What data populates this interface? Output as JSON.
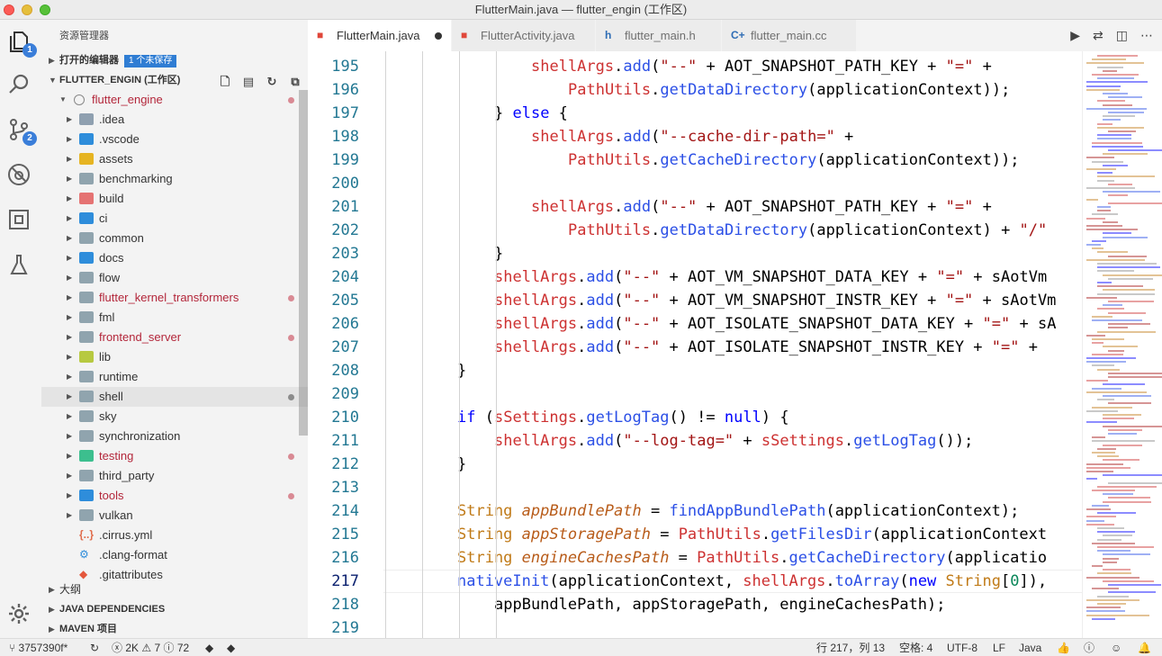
{
  "window": {
    "title": "FlutterMain.java — flutter_engin (工作区)"
  },
  "activity": {
    "explorer_badge": "1",
    "scm_badge": "2"
  },
  "sidebar": {
    "title": "资源管理器",
    "open_editors": {
      "label": "打开的编辑器",
      "badge": "1 个未保存"
    },
    "workspace": {
      "label": "FLUTTER_ENGIN (工作区)"
    },
    "tree": [
      {
        "name": "flutter_engine",
        "root": true,
        "modified": true
      },
      {
        "name": ".idea",
        "icon_color": "#8fa0b0"
      },
      {
        "name": ".vscode",
        "icon_color": "#2e8ddb"
      },
      {
        "name": "assets",
        "icon_color": "#e6b422"
      },
      {
        "name": "benchmarking",
        "icon_color": "#90a4ae"
      },
      {
        "name": "build",
        "icon_color": "#e57373"
      },
      {
        "name": "ci",
        "icon_color": "#2e8ddb"
      },
      {
        "name": "common",
        "icon_color": "#90a4ae"
      },
      {
        "name": "docs",
        "icon_color": "#2e8ddb"
      },
      {
        "name": "flow",
        "icon_color": "#90a4ae"
      },
      {
        "name": "flutter_kernel_transformers",
        "icon_color": "#90a4ae",
        "modified": true
      },
      {
        "name": "fml",
        "icon_color": "#90a4ae"
      },
      {
        "name": "frontend_server",
        "icon_color": "#90a4ae",
        "modified": true
      },
      {
        "name": "lib",
        "icon_color": "#b7c940"
      },
      {
        "name": "runtime",
        "icon_color": "#90a4ae"
      },
      {
        "name": "shell",
        "icon_color": "#90a4ae",
        "selected": true,
        "gray_dot": true
      },
      {
        "name": "sky",
        "icon_color": "#90a4ae"
      },
      {
        "name": "synchronization",
        "icon_color": "#90a4ae"
      },
      {
        "name": "testing",
        "icon_color": "#3cbf8e",
        "modified": true
      },
      {
        "name": "third_party",
        "icon_color": "#90a4ae"
      },
      {
        "name": "tools",
        "icon_color": "#2e8ddb",
        "modified": true
      },
      {
        "name": "vulkan",
        "icon_color": "#90a4ae"
      },
      {
        "name": ".cirrus.yml",
        "file": true,
        "glyph": "{..}",
        "icon_color": "#e06c4b"
      },
      {
        "name": ".clang-format",
        "file": true,
        "glyph": "⚙",
        "icon_color": "#2e8ddb"
      },
      {
        "name": ".gitattributes",
        "file": true,
        "glyph": "◆",
        "icon_color": "#e4573c"
      }
    ],
    "outline": {
      "label": "大纲"
    },
    "java_deps": {
      "label": "JAVA DEPENDENCIES"
    },
    "maven": {
      "label": "MAVEN 项目"
    }
  },
  "tabs": [
    {
      "label": "FlutterMain.java",
      "icon": "java-icon",
      "active": true,
      "dirty": true
    },
    {
      "label": "FlutterActivity.java",
      "icon": "java-icon"
    },
    {
      "label": "flutter_main.h",
      "icon": "h-icon"
    },
    {
      "label": "flutter_main.cc",
      "icon": "cpp-icon"
    }
  ],
  "editor": {
    "current_line": "217",
    "lines": [
      {
        "n": "195",
        "indent": 4,
        "t": [
          [
            "v",
            "shellArgs"
          ],
          [
            "p",
            "."
          ],
          [
            "m",
            "add"
          ],
          [
            "p",
            "("
          ],
          [
            "s",
            "\"--\""
          ],
          [
            "p",
            " + AOT_SNAPSHOT_PATH_KEY + "
          ],
          [
            "s",
            "\"=\""
          ],
          [
            "p",
            " +"
          ]
        ]
      },
      {
        "n": "196",
        "indent": 5,
        "t": [
          [
            "v",
            "PathUtils"
          ],
          [
            "p",
            "."
          ],
          [
            "m",
            "getDataDirectory"
          ],
          [
            "p",
            "(applicationContext));"
          ]
        ]
      },
      {
        "n": "197",
        "indent": 3,
        "t": [
          [
            "p",
            "} "
          ],
          [
            "k",
            "else"
          ],
          [
            "p",
            " {"
          ]
        ]
      },
      {
        "n": "198",
        "indent": 4,
        "t": [
          [
            "v",
            "shellArgs"
          ],
          [
            "p",
            "."
          ],
          [
            "m",
            "add"
          ],
          [
            "p",
            "("
          ],
          [
            "s",
            "\"--cache-dir-path=\""
          ],
          [
            "p",
            " +"
          ]
        ]
      },
      {
        "n": "199",
        "indent": 5,
        "t": [
          [
            "v",
            "PathUtils"
          ],
          [
            "p",
            "."
          ],
          [
            "m",
            "getCacheDirectory"
          ],
          [
            "p",
            "(applicationContext));"
          ]
        ]
      },
      {
        "n": "200",
        "indent": 0,
        "t": []
      },
      {
        "n": "201",
        "indent": 4,
        "t": [
          [
            "v",
            "shellArgs"
          ],
          [
            "p",
            "."
          ],
          [
            "m",
            "add"
          ],
          [
            "p",
            "("
          ],
          [
            "s",
            "\"--\""
          ],
          [
            "p",
            " + AOT_SNAPSHOT_PATH_KEY + "
          ],
          [
            "s",
            "\"=\""
          ],
          [
            "p",
            " +"
          ]
        ]
      },
      {
        "n": "202",
        "indent": 5,
        "t": [
          [
            "v",
            "PathUtils"
          ],
          [
            "p",
            "."
          ],
          [
            "m",
            "getDataDirectory"
          ],
          [
            "p",
            "(applicationContext) + "
          ],
          [
            "s",
            "\"/\""
          ]
        ]
      },
      {
        "n": "203",
        "indent": 3,
        "t": [
          [
            "p",
            "}"
          ]
        ]
      },
      {
        "n": "204",
        "indent": 3,
        "t": [
          [
            "v",
            "shellArgs"
          ],
          [
            "p",
            "."
          ],
          [
            "m",
            "add"
          ],
          [
            "p",
            "("
          ],
          [
            "s",
            "\"--\""
          ],
          [
            "p",
            " + AOT_VM_SNAPSHOT_DATA_KEY + "
          ],
          [
            "s",
            "\"=\""
          ],
          [
            "p",
            " + sAotVm"
          ]
        ]
      },
      {
        "n": "205",
        "indent": 3,
        "t": [
          [
            "v",
            "shellArgs"
          ],
          [
            "p",
            "."
          ],
          [
            "m",
            "add"
          ],
          [
            "p",
            "("
          ],
          [
            "s",
            "\"--\""
          ],
          [
            "p",
            " + AOT_VM_SNAPSHOT_INSTR_KEY + "
          ],
          [
            "s",
            "\"=\""
          ],
          [
            "p",
            " + sAotVm"
          ]
        ]
      },
      {
        "n": "206",
        "indent": 3,
        "t": [
          [
            "v",
            "shellArgs"
          ],
          [
            "p",
            "."
          ],
          [
            "m",
            "add"
          ],
          [
            "p",
            "("
          ],
          [
            "s",
            "\"--\""
          ],
          [
            "p",
            " + AOT_ISOLATE_SNAPSHOT_DATA_KEY + "
          ],
          [
            "s",
            "\"=\""
          ],
          [
            "p",
            " + sA"
          ]
        ]
      },
      {
        "n": "207",
        "indent": 3,
        "t": [
          [
            "v",
            "shellArgs"
          ],
          [
            "p",
            "."
          ],
          [
            "m",
            "add"
          ],
          [
            "p",
            "("
          ],
          [
            "s",
            "\"--\""
          ],
          [
            "p",
            " + AOT_ISOLATE_SNAPSHOT_INSTR_KEY + "
          ],
          [
            "s",
            "\"=\""
          ],
          [
            "p",
            " +"
          ]
        ]
      },
      {
        "n": "208",
        "indent": 2,
        "t": [
          [
            "p",
            "}"
          ]
        ]
      },
      {
        "n": "209",
        "indent": 0,
        "t": []
      },
      {
        "n": "210",
        "indent": 2,
        "t": [
          [
            "k",
            "if"
          ],
          [
            "p",
            " ("
          ],
          [
            "v",
            "sSettings"
          ],
          [
            "p",
            "."
          ],
          [
            "m",
            "getLogTag"
          ],
          [
            "p",
            "() != "
          ],
          [
            "k",
            "null"
          ],
          [
            "p",
            ") {"
          ]
        ]
      },
      {
        "n": "211",
        "indent": 3,
        "t": [
          [
            "v",
            "shellArgs"
          ],
          [
            "p",
            "."
          ],
          [
            "m",
            "add"
          ],
          [
            "p",
            "("
          ],
          [
            "s",
            "\"--log-tag=\""
          ],
          [
            "p",
            " + "
          ],
          [
            "v",
            "sSettings"
          ],
          [
            "p",
            "."
          ],
          [
            "m",
            "getLogTag"
          ],
          [
            "p",
            "());"
          ]
        ]
      },
      {
        "n": "212",
        "indent": 2,
        "t": [
          [
            "p",
            "}"
          ]
        ]
      },
      {
        "n": "213",
        "indent": 0,
        "t": []
      },
      {
        "n": "214",
        "indent": 2,
        "t": [
          [
            "ty",
            "String"
          ],
          [
            "p",
            " "
          ],
          [
            "vi",
            "appBundlePath"
          ],
          [
            "p",
            " = "
          ],
          [
            "m",
            "findAppBundlePath"
          ],
          [
            "p",
            "(applicationContext);"
          ]
        ]
      },
      {
        "n": "215",
        "indent": 2,
        "t": [
          [
            "ty",
            "String"
          ],
          [
            "p",
            " "
          ],
          [
            "vi",
            "appStoragePath"
          ],
          [
            "p",
            " = "
          ],
          [
            "v",
            "PathUtils"
          ],
          [
            "p",
            "."
          ],
          [
            "m",
            "getFilesDir"
          ],
          [
            "p",
            "(applicationContext"
          ]
        ]
      },
      {
        "n": "216",
        "indent": 2,
        "t": [
          [
            "ty",
            "String"
          ],
          [
            "p",
            " "
          ],
          [
            "vi",
            "engineCachesPath"
          ],
          [
            "p",
            " = "
          ],
          [
            "v",
            "PathUtils"
          ],
          [
            "p",
            "."
          ],
          [
            "m",
            "getCacheDirectory"
          ],
          [
            "p",
            "(applicatio"
          ]
        ]
      },
      {
        "n": "217",
        "indent": 2,
        "t": [
          [
            "m",
            "nativeInit"
          ],
          [
            "p",
            "(applicationContext, "
          ],
          [
            "v",
            "shellArgs"
          ],
          [
            "p",
            "."
          ],
          [
            "m",
            "toArray"
          ],
          [
            "p",
            "("
          ],
          [
            "k",
            "new"
          ],
          [
            "p",
            " "
          ],
          [
            "ty",
            "String"
          ],
          [
            "p",
            "["
          ],
          [
            "num",
            "0"
          ],
          [
            "p",
            "]),"
          ]
        ]
      },
      {
        "n": "218",
        "indent": 3,
        "t": [
          [
            "p",
            "appBundlePath, appStoragePath, engineCachesPath);"
          ]
        ]
      },
      {
        "n": "219",
        "indent": 0,
        "t": []
      }
    ]
  },
  "statusbar": {
    "branch": "3757390f*",
    "errors": "2K",
    "warnings": "7",
    "infos": "72",
    "position": "行 217，列 13",
    "spaces": "空格: 4",
    "encoding": "UTF-8",
    "eol": "LF",
    "language": "Java"
  },
  "colors": {
    "keyword": "#0000ff",
    "variable": "#cd3131",
    "method": "#2b4fe6",
    "string": "#a31515",
    "type": "#c07a17",
    "var_italic": "#b85c1a",
    "number": "#098658"
  }
}
